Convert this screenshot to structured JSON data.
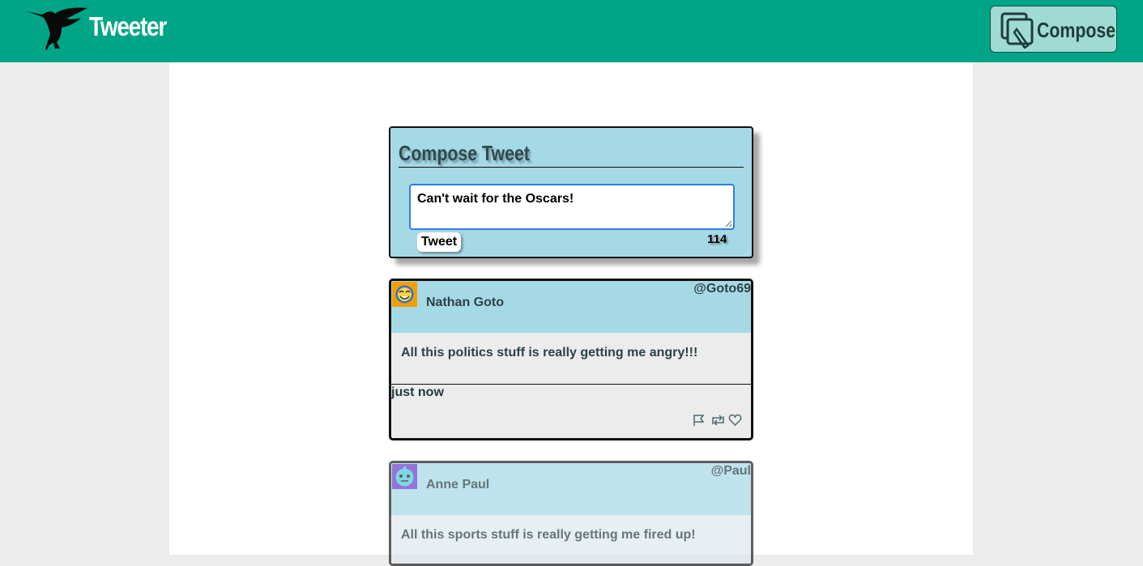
{
  "header": {
    "brand": "Tweeter",
    "logo_icon": "hummingbird-icon",
    "compose_label": "Compose",
    "compose_icon": "compose-icon",
    "colors": {
      "bar": "#00a587",
      "compose_bg": "#9fdbd2"
    }
  },
  "compose": {
    "title": "Compose Tweet",
    "text": "Can't wait for the Oscars!",
    "submit_label": "Tweet",
    "counter": "114"
  },
  "tweets": [
    {
      "name": "Nathan Goto",
      "handle": "@Goto69",
      "text": "All this politics stuff is really getting me angry!!!",
      "time": "just now",
      "avatar_icon": "avatar-emoji-icon",
      "actions": [
        "flag-icon",
        "retweet-icon",
        "heart-icon"
      ]
    },
    {
      "name": "Anne Paul",
      "handle": "@Paul",
      "text": "All this sports stuff is really getting me fired up!",
      "avatar_icon": "avatar-robot-icon"
    }
  ]
}
